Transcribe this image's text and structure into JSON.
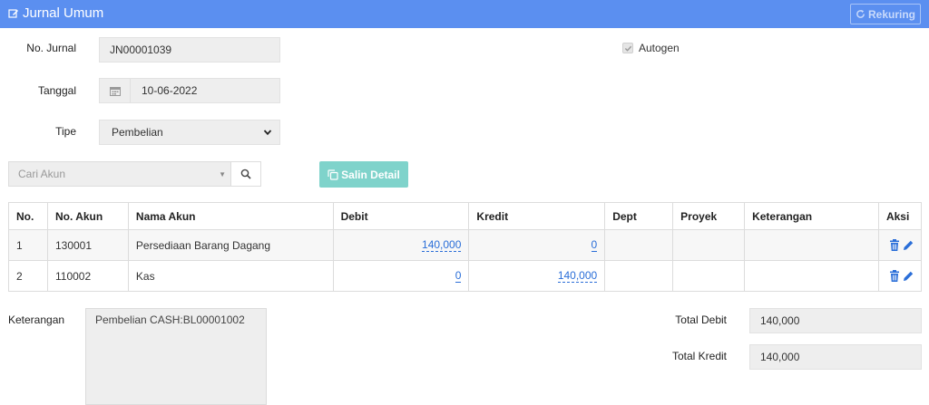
{
  "header": {
    "title": "Jurnal Umum",
    "rekuring_label": "Rekuring"
  },
  "form": {
    "no_jurnal_label": "No. Jurnal",
    "no_jurnal_value": "JN00001039",
    "tanggal_label": "Tanggal",
    "tanggal_value": "10-06-2022",
    "tipe_label": "Tipe",
    "tipe_value": "Pembelian",
    "autogen_label": "Autogen",
    "autogen_checked": true
  },
  "toolbar": {
    "cari_akun_placeholder": "Cari Akun",
    "salin_detail_label": "Salin Detail"
  },
  "table": {
    "columns": [
      "No.",
      "No. Akun",
      "Nama Akun",
      "Debit",
      "Kredit",
      "Dept",
      "Proyek",
      "Keterangan",
      "Aksi"
    ],
    "rows": [
      {
        "no": "1",
        "no_akun": "130001",
        "nama_akun": "Persediaan Barang Dagang",
        "debit": "140,000",
        "kredit": "0",
        "dept": "",
        "proyek": "",
        "keterangan": ""
      },
      {
        "no": "2",
        "no_akun": "110002",
        "nama_akun": "Kas",
        "debit": "0",
        "kredit": "140,000",
        "dept": "",
        "proyek": "",
        "keterangan": ""
      }
    ]
  },
  "footer": {
    "keterangan_label": "Keterangan",
    "keterangan_value": "Pembelian CASH:BL00001002",
    "total_debit_label": "Total Debit",
    "total_debit_value": "140,000",
    "total_kredit_label": "Total Kredit",
    "total_kredit_value": "140,000"
  },
  "colors": {
    "header_bg": "#5b8ff0",
    "accent_teal": "#7fd3cb",
    "link_blue": "#2a6ed8",
    "table_border": "#4fb0d0"
  },
  "icons": {
    "title": "edit-icon",
    "rekuring": "refresh-icon",
    "calendar": "calendar-icon",
    "search": "search-icon",
    "salin": "copy-icon",
    "delete": "trash-icon",
    "edit": "pencil-icon"
  }
}
